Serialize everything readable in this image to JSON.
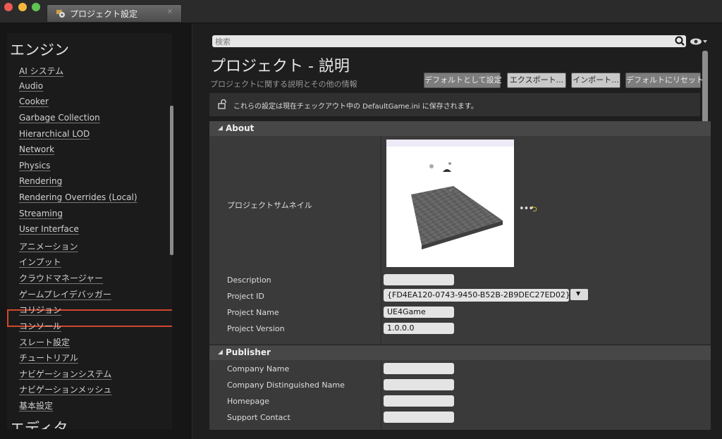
{
  "window": {
    "tab_title": "プロジェクト設定",
    "tab_close": "×"
  },
  "sidebar": {
    "category_engine": "エンジン",
    "category_editor": "エディタ",
    "items": [
      {
        "label": "AI システム"
      },
      {
        "label": "Audio"
      },
      {
        "label": "Cooker"
      },
      {
        "label": "Garbage Collection"
      },
      {
        "label": "Hierarchical LOD"
      },
      {
        "label": "Network"
      },
      {
        "label": "Physics"
      },
      {
        "label": "Rendering"
      },
      {
        "label": "Rendering Overrides (Local)"
      },
      {
        "label": "Streaming"
      },
      {
        "label": "User Interface"
      },
      {
        "label": "アニメーション"
      },
      {
        "label": "インプット"
      },
      {
        "label": "クラウドマネージャー"
      },
      {
        "label": "ゲームプレイデバッガー"
      },
      {
        "label": "コリジョン"
      },
      {
        "label": "コンソール"
      },
      {
        "label": "スレート設定"
      },
      {
        "label": "チュートリアル"
      },
      {
        "label": "ナビゲーションシステム"
      },
      {
        "label": "ナビゲーションメッシュ"
      },
      {
        "label": "基本設定"
      }
    ],
    "highlighted_item": "コリジョン"
  },
  "search": {
    "placeholder": "検索"
  },
  "header": {
    "title": "プロジェクト - 説明",
    "subtitle": "プロジェクトに関する説明とその他の情報"
  },
  "toolbar": {
    "set_default": "デフォルトとして設定",
    "export": "エクスポート...",
    "import": "インポート...",
    "reset_default": "デフォルトにリセット"
  },
  "notice": {
    "text": "これらの設定は現在チェックアウト中の DefaultGame.ini に保存されます。"
  },
  "about": {
    "title": "About",
    "thumbnail_label": "プロジェクトサムネイル",
    "description_label": "Description",
    "description_value": "",
    "project_id_label": "Project ID",
    "project_id_value": "{FD4EA120-0743-9450-B52B-2B9DEC27ED02}",
    "project_name_label": "Project Name",
    "project_name_value": "UE4Game",
    "project_version_label": "Project Version",
    "project_version_value": "1.0.0.0",
    "more_button": "•••",
    "reset_icon": "⮌"
  },
  "publisher": {
    "title": "Publisher",
    "company_name_label": "Company Name",
    "company_name_value": "",
    "company_distinguished_name_label": "Company Distinguished Name",
    "company_distinguished_name_value": "",
    "homepage_label": "Homepage",
    "homepage_value": "",
    "support_contact_label": "Support Contact",
    "support_contact_value": ""
  },
  "colors": {
    "highlight_border": "#d0472e",
    "reset_icon": "#e8d24a"
  }
}
